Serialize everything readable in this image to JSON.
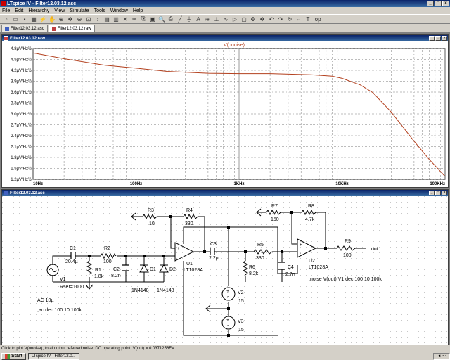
{
  "app": {
    "title": "LTspice IV - Filter12.03.12.asc",
    "window_buttons": [
      "_",
      "□",
      "×"
    ]
  },
  "menu": [
    "File",
    "Edit",
    "Hierarchy",
    "View",
    "Simulate",
    "Tools",
    "Window",
    "Help"
  ],
  "toolbar_icons": [
    "new-icon",
    "open-icon",
    "save-icon",
    "control-panel-icon",
    "run-icon",
    "halt-icon",
    "zoom-in-icon",
    "pan-icon",
    "zoom-out-icon",
    "zoom-fit-icon",
    "autorange-icon",
    "tile-icon",
    "cascade-icon",
    "close-icon",
    "cut-icon",
    "copy-icon",
    "paste-icon",
    "find-icon",
    "print-icon",
    "wire-icon",
    "ground-icon",
    "label-icon",
    "resistor-icon",
    "capacitor-icon",
    "inductor-icon",
    "diode-icon",
    "component-icon",
    "move-icon",
    "drag-icon",
    "undo-icon",
    "redo-icon",
    "rotate-icon",
    "mirror-icon",
    "text-icon",
    "spice-directive-icon"
  ],
  "tabs": [
    {
      "label": "Filter12.03.12.asc",
      "icon": "schematic-icon"
    },
    {
      "label": "Filter12.03.12.raw",
      "icon": "waveform-icon"
    }
  ],
  "plot_window": {
    "title": "Filter12.03.12.raw"
  },
  "schematic_window": {
    "title": "Filter12.03.12.asc"
  },
  "chart_data": {
    "type": "line",
    "title": "V(onoise)",
    "x_scale": "log",
    "xlim": [
      10,
      100000
    ],
    "x_ticks": [
      "10Hz",
      "100Hz",
      "1KHz",
      "10KHz",
      "100KHz"
    ],
    "y_ticks": [
      "4.8µV/Hz½",
      "4.5µV/Hz½",
      "4.2µV/Hz½",
      "3.9µV/Hz½",
      "3.6µV/Hz½",
      "3.3µV/Hz½",
      "3.0µV/Hz½",
      "2.7µV/Hz½",
      "2.4µV/Hz½",
      "2.1µV/Hz½",
      "1.8µV/Hz½",
      "1.5µV/Hz½",
      "1.2µV/Hz½"
    ],
    "ylim": [
      1.2,
      4.8
    ],
    "grid": true,
    "series": [
      {
        "name": "V(onoise)",
        "color": "#b3401e",
        "x": [
          10,
          20,
          50,
          100,
          200,
          500,
          1000,
          2000,
          5000,
          8000,
          10000,
          15000,
          20000,
          30000,
          50000,
          70000,
          100000
        ],
        "y": [
          4.68,
          4.52,
          4.34,
          4.26,
          4.17,
          4.12,
          4.11,
          4.11,
          4.08,
          4.04,
          3.98,
          3.8,
          3.58,
          3.05,
          2.25,
          1.75,
          1.28
        ]
      }
    ]
  },
  "schematic": {
    "labels": {
      "r3_name": "R3",
      "r3_val": "10",
      "r4_name": "R4",
      "r4_val": "330",
      "r7_name": "R7",
      "r7_val": "150",
      "r8_name": "R8",
      "r8_val": "4.7k",
      "r9_name": "R9",
      "r9_val": "100",
      "out": "out",
      "c1_name": "C1",
      "c1_val": "20.4µ",
      "r2_name": "R2",
      "r2_val": "100",
      "c3_name": "C3",
      "c3_val": "2.2µ",
      "r5_name": "R5",
      "r5_val": "330",
      "u1_name": "U1",
      "u1_val": "LT1028A",
      "u2_name": "U2",
      "u2_val": "LT1028A",
      "v1_name": "V1",
      "v1_rser": "Rser=1000",
      "r1_name": "R1",
      "r1_val": "1.8k",
      "c2_name": "C2",
      "c2_val": "8.2n",
      "d1_name": "D1",
      "d1_val": "1N4148",
      "d2_name": "D2",
      "d2_val": "1N4148",
      "r6_name": "R6",
      "r6_val": "8.2k",
      "c4_name": "C4",
      "c4_val": "2.7n",
      "v2_name": "V2",
      "v2_val": "15",
      "v3_name": "V3",
      "v3_val": "15",
      "directive_noise": ".noise V(out) V1 dec 100 10 100k",
      "ac": "AC 10µ",
      "directive_ac": ";ac dec 100 10 100k"
    }
  },
  "status": "Click to plot V(onoise), total output referred noise.  DC operating point: V(out) = 0.0371256FV",
  "taskbar": {
    "start": "Start",
    "task": "LTspice IV - Filter12.0...",
    "tray": "◄ ▪ ▪"
  }
}
